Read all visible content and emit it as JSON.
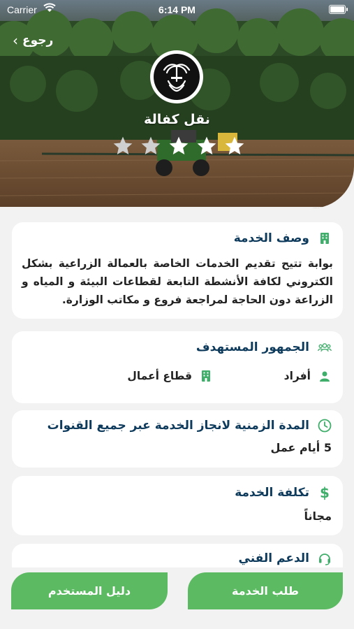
{
  "status_bar": {
    "carrier": "Carrier",
    "time": "6:14 PM"
  },
  "header": {
    "back_label": "رجوع",
    "service_title": "نقل كفالة",
    "rating": 3,
    "rating_max": 5
  },
  "description": {
    "title": "وصف الخدمة",
    "text": "بوابة تتيح تقديم الخدمات الخاصة بالعمالة الزراعية بشكل الكتروني لكافة الأنشطة التابعة لقطاعات البيئة و المياه و الزراعة دون الحاجة لمراجعة فروع و مكاتب الوزارة."
  },
  "audience": {
    "title": "الجمهور المستهدف",
    "items": [
      "أفراد",
      "قطاع أعمال"
    ]
  },
  "duration": {
    "title": "المدة الزمنية لانجاز الخدمة عبر جميع القنوات",
    "value": "5 أيام عمل"
  },
  "cost": {
    "title": "تكلفة الخدمة",
    "value": "مجاناً"
  },
  "support": {
    "title": "الدعم الفني"
  },
  "actions": {
    "request_label": "طلب الخدمة",
    "guide_label": "دليل المستخدم"
  },
  "colors": {
    "accent": "#5cbb62",
    "heading": "#0e3a5c",
    "icon": "#3fae6a"
  }
}
